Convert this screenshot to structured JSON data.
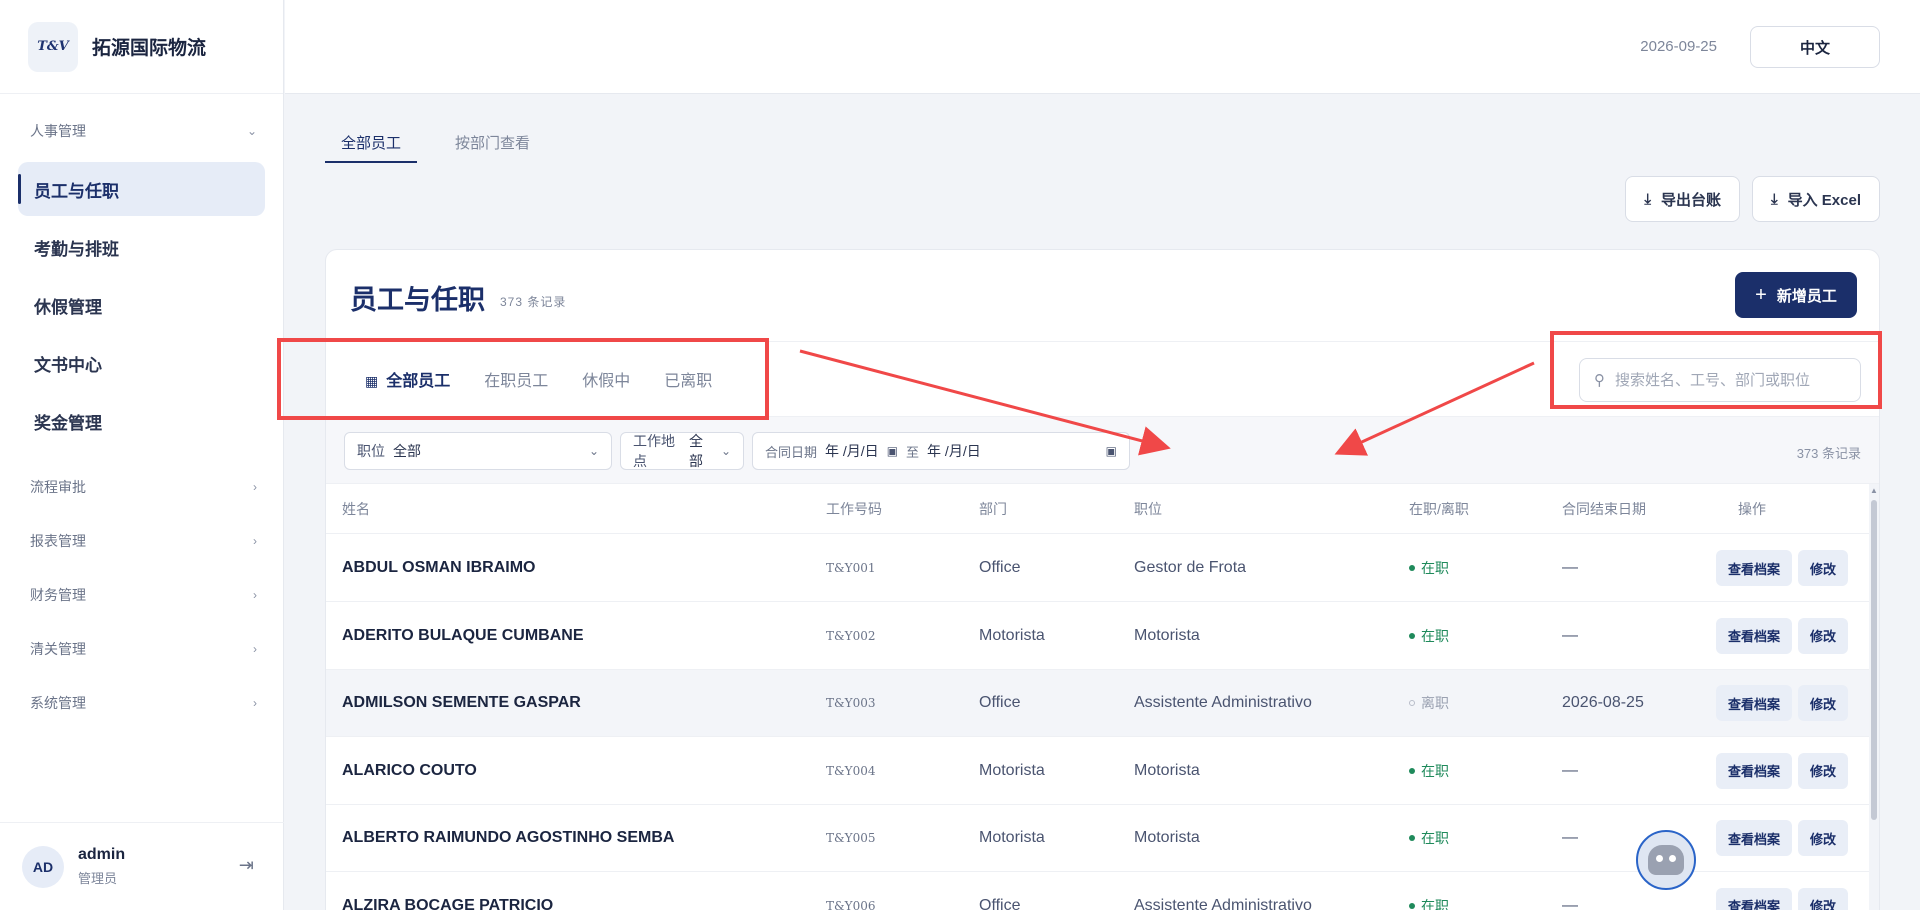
{
  "brand": {
    "logo_text": "T&V",
    "name": "拓源国际物流"
  },
  "sidebar": {
    "groups": [
      {
        "label": "人事管理",
        "expanded": true
      },
      {
        "label": "流程审批"
      },
      {
        "label": "报表管理"
      },
      {
        "label": "财务管理"
      },
      {
        "label": "清关管理"
      },
      {
        "label": "系统管理"
      }
    ],
    "items": [
      {
        "label": "员工与任职",
        "active": true
      },
      {
        "label": "考勤与排班"
      },
      {
        "label": "休假管理"
      },
      {
        "label": "文书中心"
      },
      {
        "label": "奖金管理"
      }
    ],
    "user": {
      "initials": "AD",
      "name": "admin",
      "role": "管理员"
    }
  },
  "header": {
    "date": "2026-09-25",
    "lang": "中文"
  },
  "view_tabs": [
    {
      "label": "全部员工",
      "active": true
    },
    {
      "label": "按部门查看"
    }
  ],
  "toolbar": {
    "export_label": "导出台账",
    "import_label": "导入 Excel"
  },
  "card": {
    "title": "员工与任职",
    "count": "373 条记录",
    "add_label": "新增员工",
    "status_tabs": [
      {
        "label": "全部员工",
        "active": true
      },
      {
        "label": "在职员工"
      },
      {
        "label": "休假中"
      },
      {
        "label": "已离职"
      }
    ],
    "search_placeholder": "搜索姓名、工号、部门或职位"
  },
  "filters": {
    "position_label": "职位",
    "position_value": "全部",
    "location_label": "工作地点",
    "location_value": "全部",
    "contract_label": "合同日期",
    "date_from": "年 /月/日",
    "to_label": "至",
    "date_to": "年 /月/日",
    "count": "373 条记录"
  },
  "table": {
    "columns": [
      "姓名",
      "工作号码",
      "部门",
      "职位",
      "在职/离职",
      "合同结束日期",
      "操作"
    ],
    "view_label": "查看档案",
    "edit_label": "修改",
    "rows": [
      {
        "name": "ABDUL OSMAN IBRAIMO",
        "id": "T&Y001",
        "dept": "Office",
        "position": "Gestor de Frota",
        "status": "在职",
        "active": true,
        "end": "—"
      },
      {
        "name": "ADERITO BULAQUE CUMBANE",
        "id": "T&Y002",
        "dept": "Motorista",
        "position": "Motorista",
        "status": "在职",
        "active": true,
        "end": "—"
      },
      {
        "name": "ADMILSON SEMENTE GASPAR",
        "id": "T&Y003",
        "dept": "Office",
        "position": "Assistente Administrativo",
        "status": "离职",
        "active": false,
        "end": "2026-08-25"
      },
      {
        "name": "ALARICO COUTO",
        "id": "T&Y004",
        "dept": "Motorista",
        "position": "Motorista",
        "status": "在职",
        "active": true,
        "end": "—"
      },
      {
        "name": "ALBERTO RAIMUNDO AGOSTINHO SEMBA",
        "id": "T&Y005",
        "dept": "Motorista",
        "position": "Motorista",
        "status": "在职",
        "active": true,
        "end": "—"
      },
      {
        "name": "ALZIRA BOCAGE PATRICIO",
        "id": "T&Y006",
        "dept": "Office",
        "position": "Assistente Administrativo",
        "status": "在职",
        "active": true,
        "end": "—"
      }
    ]
  },
  "colors": {
    "brand": "#1b2f6a",
    "active_status": "#1f8a5b",
    "annotation": "#f04848"
  }
}
